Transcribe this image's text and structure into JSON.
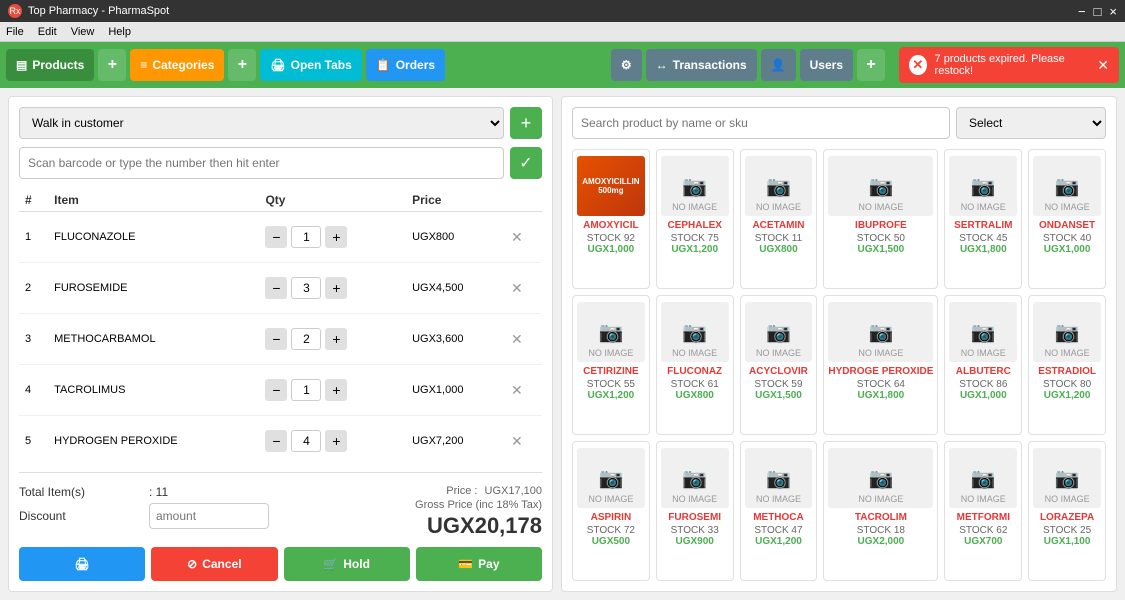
{
  "titleBar": {
    "title": "Top Pharmacy - PharmaSpot",
    "icon": "Rx",
    "controls": [
      "−",
      "□",
      "×"
    ]
  },
  "menuBar": {
    "items": [
      "File",
      "Edit",
      "View",
      "Help"
    ]
  },
  "topNav": {
    "left": [
      {
        "label": "Products",
        "icon": "▤",
        "type": "green"
      },
      {
        "label": "+",
        "type": "small-plus"
      },
      {
        "label": "Categories",
        "icon": "≡",
        "type": "orange"
      },
      {
        "label": "+",
        "type": "small-plus"
      },
      {
        "label": "Open Tabs",
        "icon": "🖨",
        "type": "teal"
      },
      {
        "label": "Orders",
        "icon": "📋",
        "type": "blue-nav"
      }
    ],
    "right": [
      {
        "label": "⚙",
        "type": "gray-nav"
      },
      {
        "label": "Transactions",
        "icon": "↔",
        "type": "gray-nav"
      },
      {
        "label": "👤",
        "type": "gray-nav"
      },
      {
        "label": "Users",
        "type": "gray-nav"
      },
      {
        "label": "+",
        "type": "small-plus"
      }
    ]
  },
  "alert": {
    "message": "7 products expired. Please restock!",
    "type": "error"
  },
  "left": {
    "customerPlaceholder": "Walk in customer",
    "barcodePlaceholder": "Scan barcode or type the number then hit enter",
    "tableHeaders": [
      "#",
      "Item",
      "Qty",
      "Price"
    ],
    "orderItems": [
      {
        "num": "1",
        "name": "FLUCONAZOLE",
        "qty": "1",
        "price": "UGX800"
      },
      {
        "num": "2",
        "name": "FUROSEMIDE",
        "qty": "3",
        "price": "UGX4,500"
      },
      {
        "num": "3",
        "name": "METHOCARBAMOL",
        "qty": "2",
        "price": "UGX3,600"
      },
      {
        "num": "4",
        "name": "TACROLIMUS",
        "qty": "1",
        "price": "UGX1,000"
      },
      {
        "num": "5",
        "name": "HYDROGEN PEROXIDE",
        "qty": "4",
        "price": "UGX7,200"
      }
    ],
    "totals": {
      "totalItemsLabel": "Total Item(s)",
      "totalItemsValue": ": 11",
      "discountLabel": "Discount",
      "discountPlaceholder": "amount",
      "priceLabel": "Price :",
      "priceValue": "UGX17,100",
      "grossLabel": "Gross Price (inc 18% Tax)",
      "grossValue": "UGX20,178"
    },
    "buttons": {
      "print": "🖨",
      "cancel": "Cancel",
      "hold": "Hold",
      "pay": "Pay"
    }
  },
  "right": {
    "searchPlaceholder": "Search product by name or sku",
    "categorySelect": "Select",
    "products": [
      {
        "name": "AMOXYICIL",
        "stock": "STOCK 92",
        "price": "UGX1,000",
        "hasImage": true,
        "imageLabel": "AMOXYICILLIN"
      },
      {
        "name": "CEPHALEX",
        "stock": "STOCK 75",
        "price": "UGX1,200",
        "hasImage": false
      },
      {
        "name": "ACETAMIN",
        "stock": "STOCK 11",
        "price": "UGX800",
        "hasImage": false
      },
      {
        "name": "IBUPROFE",
        "stock": "STOCK 50",
        "price": "UGX1,500",
        "hasImage": false
      },
      {
        "name": "SERTRALIM",
        "stock": "STOCK 45",
        "price": "UGX1,800",
        "hasImage": false
      },
      {
        "name": "ONDANSET",
        "stock": "STOCK 40",
        "price": "UGX1,000",
        "hasImage": false
      },
      {
        "name": "CETIRIZINE",
        "stock": "STOCK 55",
        "price": "UGX1,200",
        "hasImage": false
      },
      {
        "name": "FLUCONAZ",
        "stock": "STOCK 61",
        "price": "UGX800",
        "hasImage": false
      },
      {
        "name": "ACYCLOVIR",
        "stock": "STOCK 59",
        "price": "UGX1,500",
        "hasImage": false
      },
      {
        "name": "HYDROGE PEROXIDE",
        "stock": "STOCK 64",
        "price": "UGX1,800",
        "hasImage": false
      },
      {
        "name": "ALBUTERC",
        "stock": "STOCK 86",
        "price": "UGX1,000",
        "hasImage": false
      },
      {
        "name": "ESTRADIOL",
        "stock": "STOCK 80",
        "price": "UGX1,200",
        "hasImage": false
      },
      {
        "name": "ASPIRIN",
        "stock": "STOCK 72",
        "price": "UGX500",
        "hasImage": false
      },
      {
        "name": "FUROSEMI",
        "stock": "STOCK 33",
        "price": "UGX900",
        "hasImage": false
      },
      {
        "name": "METHOCA",
        "stock": "STOCK 47",
        "price": "UGX1,200",
        "hasImage": false
      },
      {
        "name": "TACROLIM",
        "stock": "STOCK 18",
        "price": "UGX2,000",
        "hasImage": false
      },
      {
        "name": "METFORMI",
        "stock": "STOCK 62",
        "price": "UGX700",
        "hasImage": false
      },
      {
        "name": "LORAZEPA",
        "stock": "STOCK 25",
        "price": "UGX1,100",
        "hasImage": false
      }
    ]
  }
}
